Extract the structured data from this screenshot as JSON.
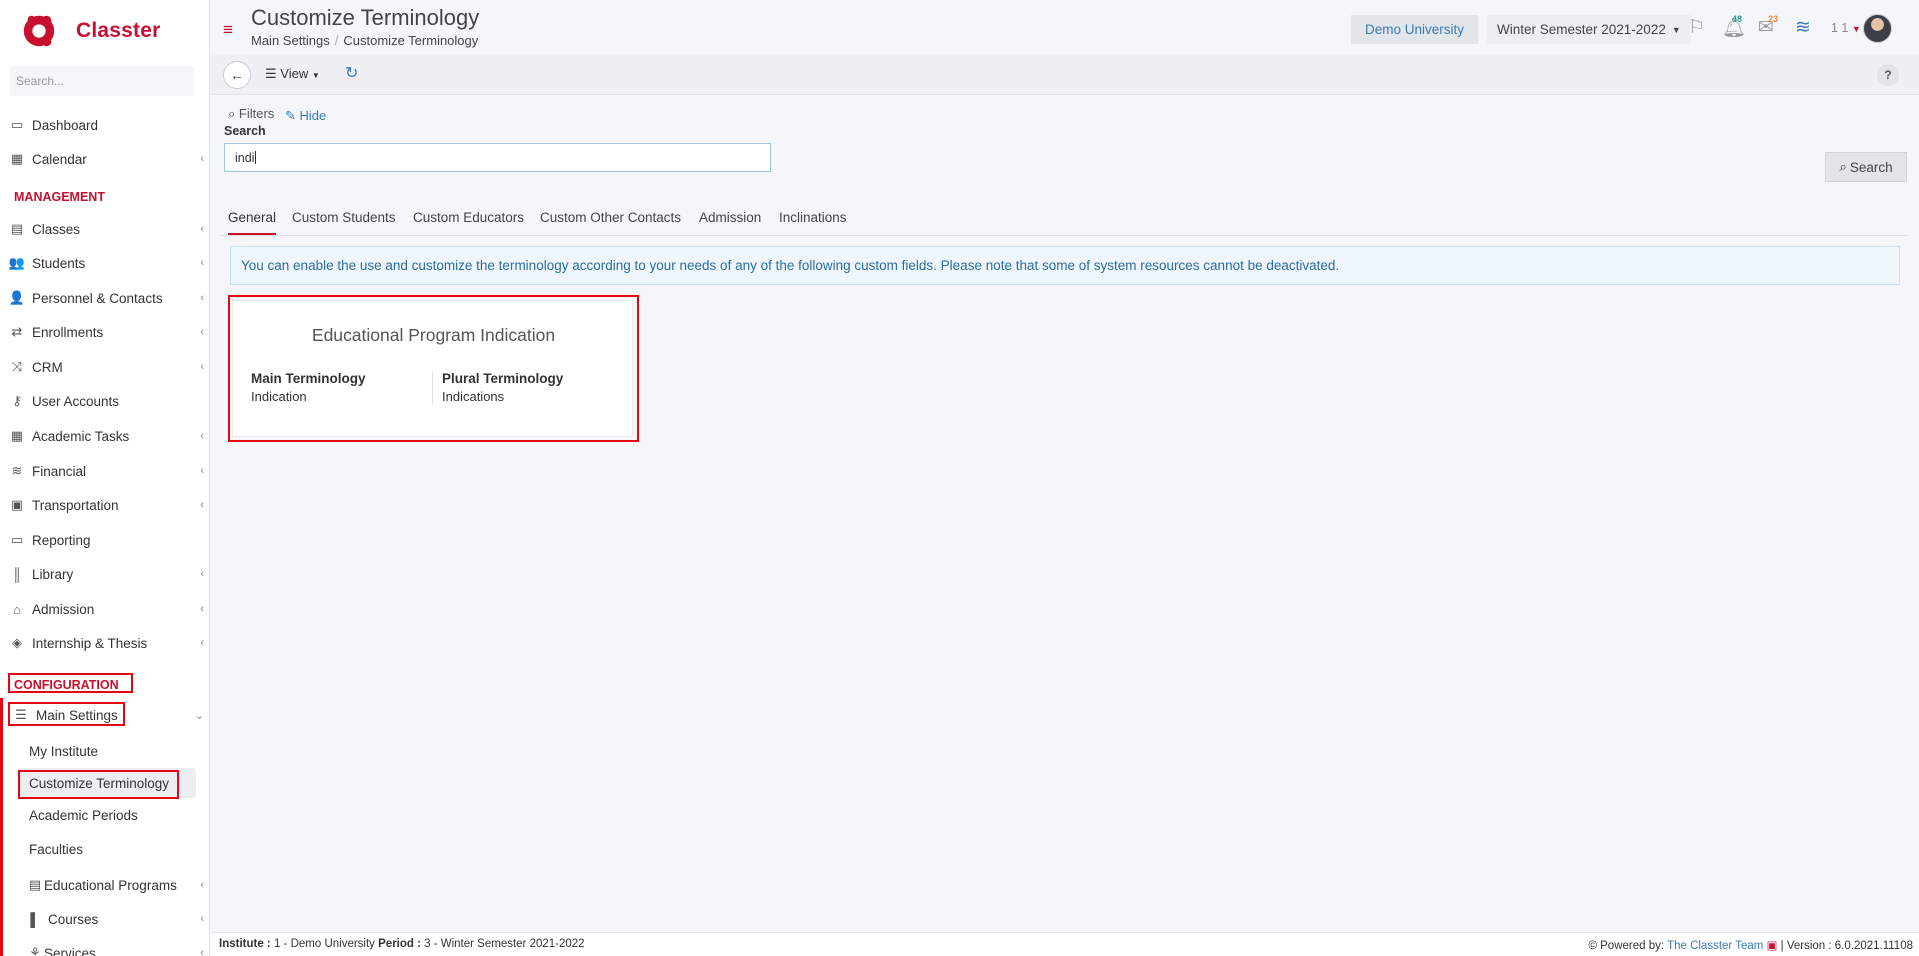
{
  "app": {
    "name": "Classter"
  },
  "sidebar": {
    "search_placeholder": "Search...",
    "items_top": [
      {
        "label": "Dashboard",
        "icon": "laptop-icon",
        "chevron": false
      },
      {
        "label": "Calendar",
        "icon": "calendar-icon",
        "chevron": true
      }
    ],
    "management_heading": "MANAGEMENT",
    "management_items": [
      {
        "label": "Classes",
        "icon": "classes-icon",
        "chevron": true
      },
      {
        "label": "Students",
        "icon": "students-icon",
        "chevron": true
      },
      {
        "label": "Personnel & Contacts",
        "icon": "personnel-icon",
        "chevron": true
      },
      {
        "label": "Enrollments",
        "icon": "exchange-icon",
        "chevron": true
      },
      {
        "label": "CRM",
        "icon": "crm-icon",
        "chevron": true
      },
      {
        "label": "User Accounts",
        "icon": "key-icon",
        "chevron": false
      },
      {
        "label": "Academic Tasks",
        "icon": "grid-icon",
        "chevron": true
      },
      {
        "label": "Financial",
        "icon": "coins-icon",
        "chevron": true
      },
      {
        "label": "Transportation",
        "icon": "bus-icon",
        "chevron": true
      },
      {
        "label": "Reporting",
        "icon": "printer-icon",
        "chevron": false
      },
      {
        "label": "Library",
        "icon": "books-icon",
        "chevron": true
      },
      {
        "label": "Admission",
        "icon": "institution-icon",
        "chevron": true
      },
      {
        "label": "Internship & Thesis",
        "icon": "cube-icon",
        "chevron": true
      }
    ],
    "configuration_heading": "CONFIGURATION",
    "main_settings": {
      "label": "Main Settings",
      "icon": "sliders-icon"
    },
    "sub_items": [
      {
        "label": "My Institute",
        "active": false
      },
      {
        "label": "Customize Terminology",
        "active": true
      },
      {
        "label": "Academic Periods",
        "active": false
      },
      {
        "label": "Faculties",
        "active": false
      }
    ],
    "sub_items_icon": [
      {
        "label": "Educational Programs",
        "icon": "programs-icon",
        "chevron": true
      },
      {
        "label": "Courses",
        "icon": "book-icon",
        "chevron": true
      },
      {
        "label": "Services",
        "icon": "services-icon",
        "chevron": true
      }
    ]
  },
  "header": {
    "title": "Customize Terminology",
    "breadcrumb": [
      "Main Settings",
      "Customize Terminology"
    ],
    "institution": "Demo University",
    "semester": "Winter Semester 2021-2022",
    "notifications_count": "48",
    "messages_count": "23",
    "user_label": "1 1"
  },
  "toolbar": {
    "view_label": "View",
    "help_label": "?"
  },
  "filters": {
    "filters_label": "Filters",
    "hide_label": "Hide",
    "search_label": "Search",
    "search_value": "indi",
    "search_button": "Search"
  },
  "tabs": [
    {
      "label": "General",
      "active": true
    },
    {
      "label": "Custom Students",
      "active": false
    },
    {
      "label": "Custom Educators",
      "active": false
    },
    {
      "label": "Custom Other Contacts",
      "active": false
    },
    {
      "label": "Admission",
      "active": false
    },
    {
      "label": "Inclinations",
      "active": false
    }
  ],
  "alert": {
    "text": "You can enable the use and customize the terminology according to your needs of any of the following custom fields. Please note that some of system resources cannot be deactivated."
  },
  "card": {
    "title": "Educational Program Indication",
    "main_label": "Main Terminology",
    "main_value": "Indication",
    "plural_label": "Plural Terminology",
    "plural_value": "Indications"
  },
  "footer": {
    "institute_label": "Institute :",
    "institute_value": "1 - Demo University",
    "period_label": "Period :",
    "period_value": "3 - Winter Semester 2021-2022",
    "powered_by": "Powered by:",
    "team": "The Classter Team",
    "version": "| Version : 6.0.2021.11108"
  },
  "colors": {
    "brand": "#c8102e",
    "link": "#3a7bb5",
    "highlight_box": "#e30613"
  }
}
